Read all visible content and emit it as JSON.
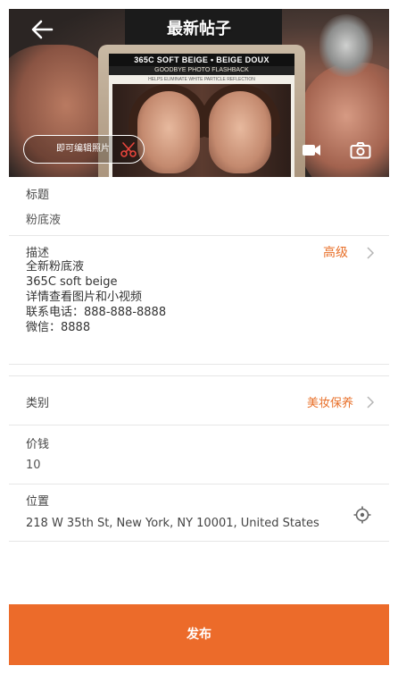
{
  "header": {
    "title": "最新帖子",
    "edit_photo_label": "即可编辑照片",
    "product_label_top": "365C SOFT BEIGE • BEIGE DOUX",
    "product_label_mid": "GOODBYE PHOTO FLASHBACK",
    "product_label_fine": "HELPS ELIMINATE WHITE PARTICLE REFLECTION"
  },
  "form": {
    "title_label": "标题",
    "title_value": "粉底液",
    "desc_label": "描述",
    "advanced_label": "高级",
    "desc_lines": [
      "全新粉底液",
      "365C soft beige",
      "详情查看图片和小视频",
      "联系电话：888-888-8888",
      "微信：8888"
    ],
    "category_label": "类别",
    "category_value": "美妆保养",
    "price_label": "价钱",
    "price_value": "10",
    "location_label": "位置",
    "location_value": "218 W 35th St, New York, NY  10001, United States"
  },
  "publish_label": "发布",
  "colors": {
    "accent": "#ec6b2a",
    "accent_text": "#e8702a"
  },
  "icons": [
    "back-arrow-icon",
    "scissors-icon",
    "video-camera-icon",
    "camera-icon",
    "chevron-right-icon",
    "location-target-icon"
  ]
}
